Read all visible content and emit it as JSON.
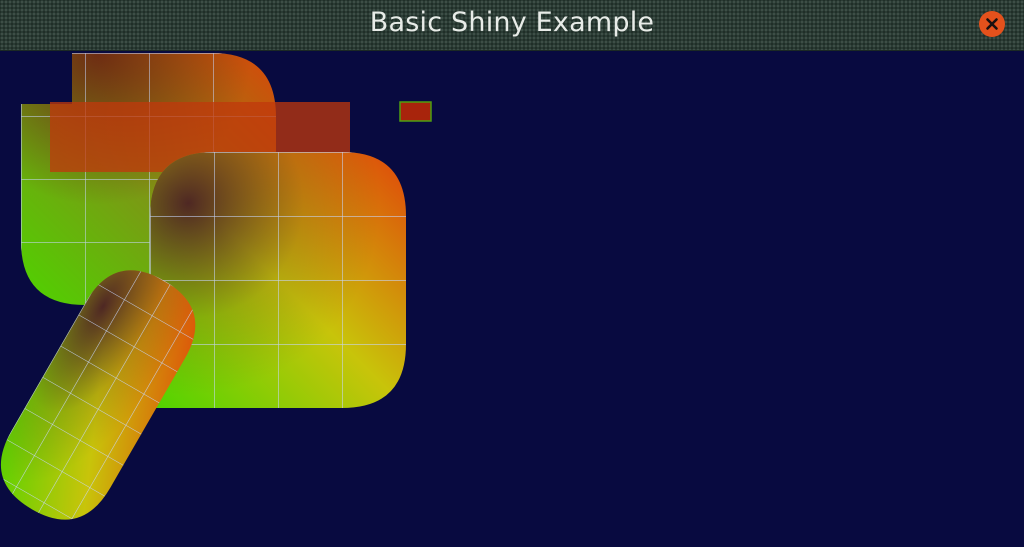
{
  "window": {
    "title": "Basic Shiny Example",
    "close_icon": "close-icon"
  },
  "scene": {
    "background": "#080a40",
    "gradient_colors": {
      "dark_red": "#7a1c12",
      "red_orange": "#e0460a",
      "yellow": "#c8c40a",
      "green": "#4ed400",
      "olive_green": "#4a7a1a"
    },
    "grid_line_color": "#c8d8ff",
    "overlay_rect_color": "#c0380c",
    "small_rect_color": "#a8240c",
    "small_rect_border": "#4ea010"
  }
}
